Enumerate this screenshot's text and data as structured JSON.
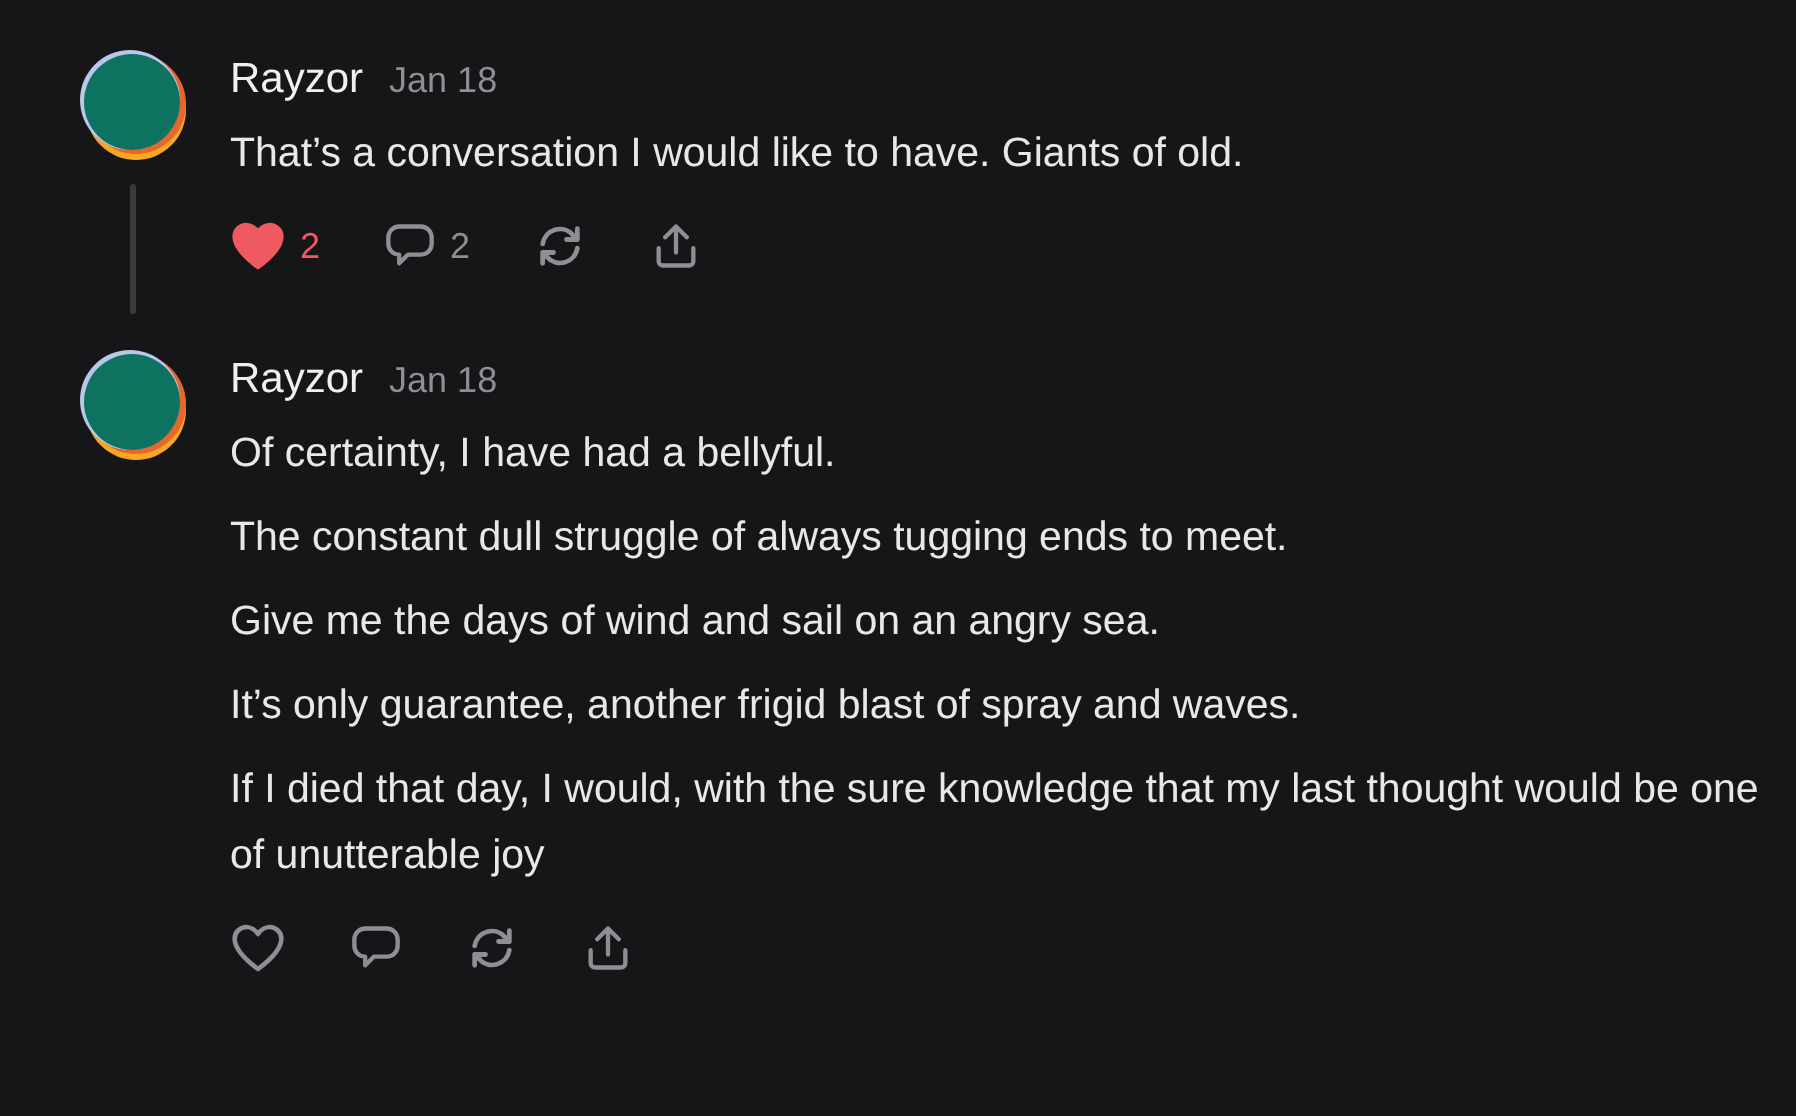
{
  "comments": [
    {
      "author": "Rayzor",
      "date": "Jan 18",
      "paragraphs": [
        "That’s a conversation I would like to have. Giants of old."
      ],
      "liked": true,
      "like_count": "2",
      "reply_count": "2",
      "has_thread": true
    },
    {
      "author": "Rayzor",
      "date": "Jan 18",
      "paragraphs": [
        "Of certainty, I have had a bellyful.",
        "The constant dull struggle of always tugging ends to meet.",
        "Give me the days of wind and sail on an angry sea.",
        "It’s only guarantee, another frigid blast of spray and waves.",
        "If I died that day, I would, with the sure knowledge that my last thought would be one of unutterable joy"
      ],
      "liked": false,
      "has_thread": false
    }
  ]
}
